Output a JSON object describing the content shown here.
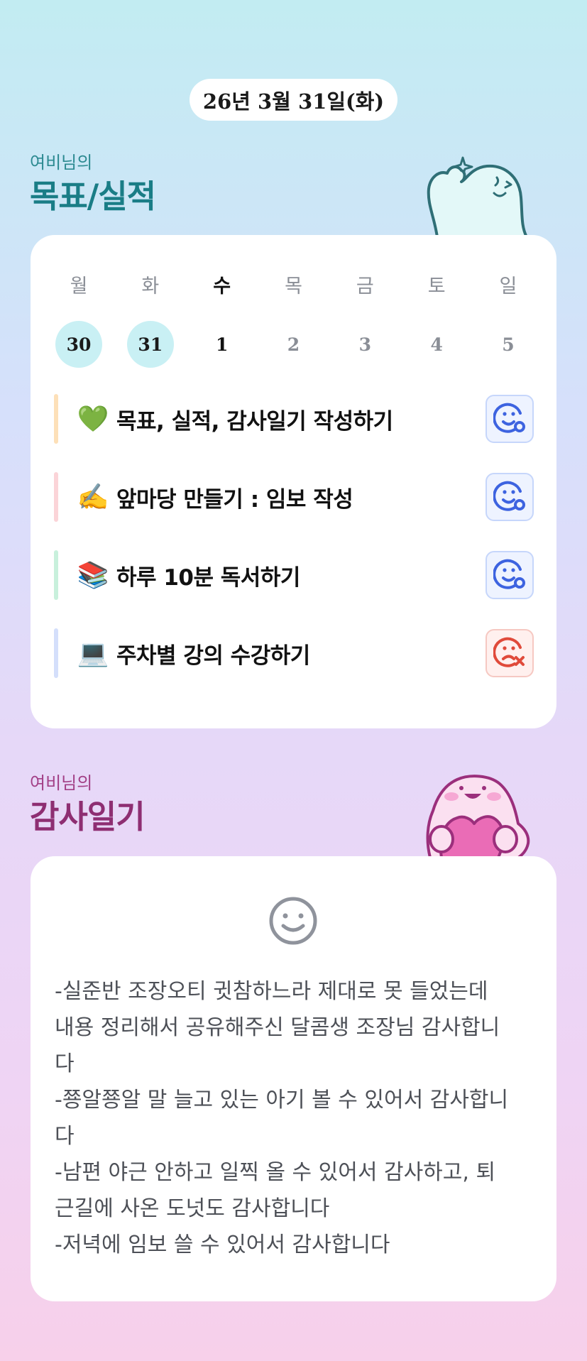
{
  "date": "26년 3월 31일(화)",
  "goals_section": {
    "subtitle": "여비님의",
    "title": "목표/실적"
  },
  "week": [
    {
      "name": "월",
      "num": "30",
      "state": "past"
    },
    {
      "name": "화",
      "num": "31",
      "state": "past"
    },
    {
      "name": "수",
      "num": "1",
      "state": "today"
    },
    {
      "name": "목",
      "num": "2",
      "state": "future"
    },
    {
      "name": "금",
      "num": "3",
      "state": "future"
    },
    {
      "name": "토",
      "num": "4",
      "state": "future"
    },
    {
      "name": "일",
      "num": "5",
      "state": "future"
    }
  ],
  "goals": [
    {
      "emoji": "💚",
      "label": "목표, 실적, 감사일기 작성하기",
      "bar_color": "#fde0b8",
      "status": "done"
    },
    {
      "emoji": "✍️",
      "label": "앞마당 만들기 : 임보 작성",
      "bar_color": "#fbd4d8",
      "status": "done"
    },
    {
      "emoji": "📚",
      "label": "하루 10분 독서하기",
      "bar_color": "#c8f0dc",
      "status": "done"
    },
    {
      "emoji": "💻",
      "label": "주차별 강의 수강하기",
      "bar_color": "#d4dffb",
      "status": "missed"
    }
  ],
  "gratitude_section": {
    "subtitle": "여비님의",
    "title": "감사일기"
  },
  "gratitude_text": "-실준반 조장오티 귓참하느라 제대로 못 들었는데\n내용 정리해서 공유해주신 달콤생 조장님 감사합니\n다\n-쭁알쭁알 말 늘고 있는 아기 볼 수 있어서 감사합니\n다\n-남편 야근 안하고 일찍 올 수 있어서 감사하고, 퇴\n근길에 사온 도넛도 감사합니다\n-저녁에 임보 쓸 수 있어서 감사합니다",
  "colors": {
    "accent_teal": "#1a7d86",
    "accent_plum": "#8e2e72",
    "status_ok": "#3d63e0",
    "status_bad": "#e04a3a",
    "past_day_bg": "#c9f0f4"
  },
  "icons": {
    "status_ok": "smile-check-icon",
    "status_bad": "sad-x-icon",
    "diary_mood": "smile-face-icon"
  }
}
